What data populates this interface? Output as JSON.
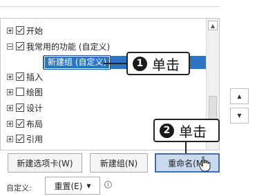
{
  "tree": {
    "items": [
      {
        "label": "开始",
        "checked": true,
        "expander": "plus"
      },
      {
        "label": "我常用的功能 (自定义)",
        "checked": true,
        "expander": "minus"
      },
      {
        "label": "新建组 (自定义)",
        "selected": true
      },
      {
        "label": "插入",
        "checked": true,
        "expander": "plus"
      },
      {
        "label": "绘图",
        "checked": false,
        "expander": "plus"
      },
      {
        "label": "设计",
        "checked": true,
        "expander": "plus"
      },
      {
        "label": "布局",
        "checked": true,
        "expander": "plus"
      },
      {
        "label": "引用",
        "checked": true,
        "expander": "plus"
      }
    ]
  },
  "callouts": {
    "step1": {
      "number": "1",
      "text": "单击"
    },
    "step2": {
      "number": "2",
      "text": "单击"
    }
  },
  "buttons": {
    "new_tab": "新建选项卡(W)",
    "new_group": "新建组(N)",
    "rename": "重命名(M)"
  },
  "footer": {
    "label": "自定义:",
    "reset": "重置(E)",
    "reset_arrow": "▼",
    "info": "ⓘ"
  },
  "icons": {
    "up": "▲",
    "down": "▼"
  },
  "colors": {
    "selection": "#2e74c4",
    "rename_button": "#c9d9ee"
  }
}
